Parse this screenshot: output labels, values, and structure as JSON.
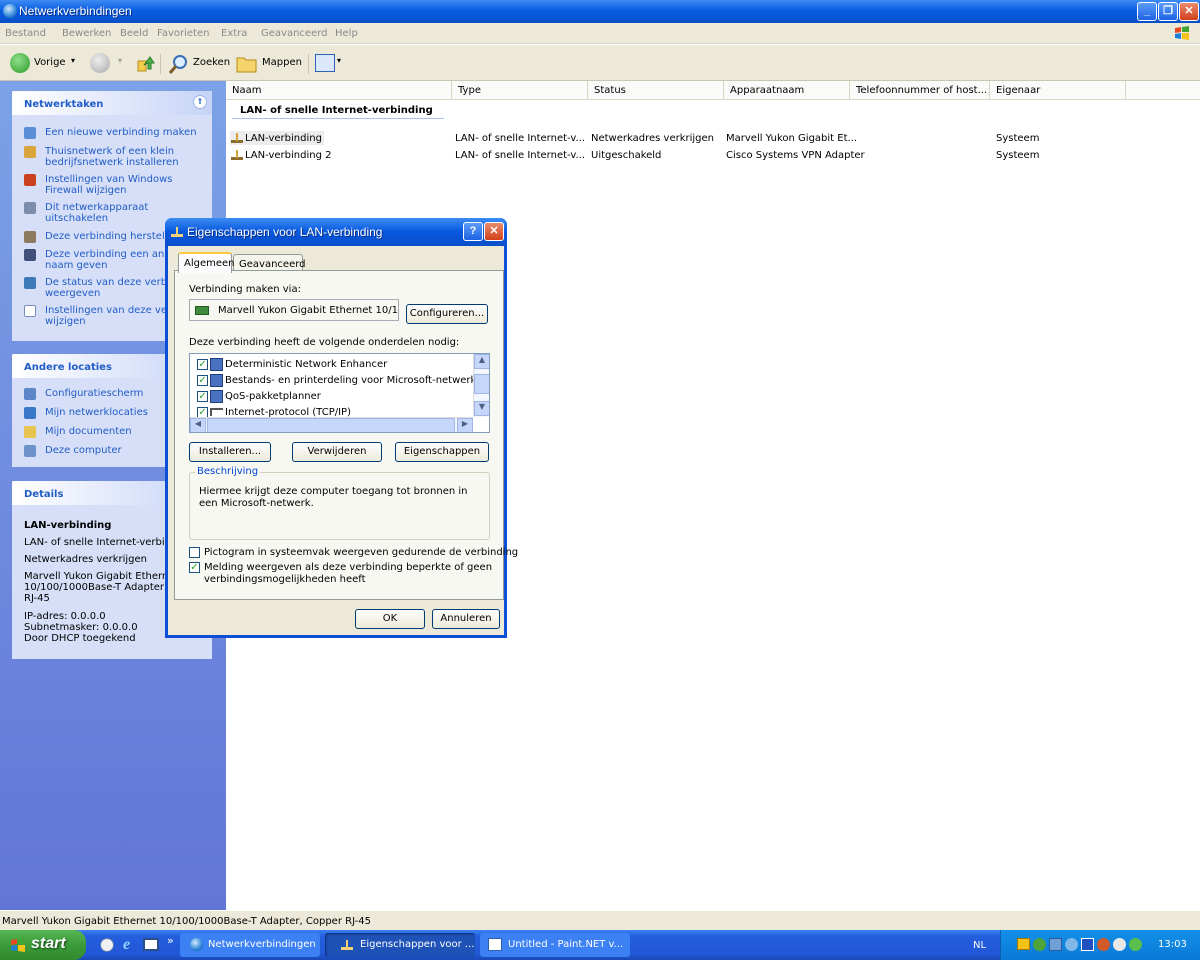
{
  "window": {
    "title": "Netwerkverbindingen"
  },
  "menu": [
    "Bestand",
    "Bewerken",
    "Beeld",
    "Favorieten",
    "Extra",
    "Geavanceerd",
    "Help"
  ],
  "toolbar": {
    "back": "Vorige",
    "search": "Zoeken",
    "folders": "Mappen"
  },
  "tasks_panel": {
    "title": "Netwerktaken",
    "items": [
      {
        "l1": "Een nieuwe verbinding maken",
        "l2": ""
      },
      {
        "l1": "Thuisnetwerk of een klein",
        "l2": "bedrijfsnetwerk installeren"
      },
      {
        "l1": "Instellingen van Windows",
        "l2": "Firewall wijzigen"
      },
      {
        "l1": "Dit netwerkapparaat",
        "l2": "uitschakelen"
      },
      {
        "l1": "Deze verbinding herstellen",
        "l2": ""
      },
      {
        "l1": "Deze verbinding een ander",
        "l2": "naam geven"
      },
      {
        "l1": "De status van deze verbind",
        "l2": "weergeven"
      },
      {
        "l1": "Instellingen van deze verb",
        "l2": "wijzigen"
      }
    ]
  },
  "places_panel": {
    "title": "Andere locaties",
    "items": [
      "Configuratiescherm",
      "Mijn netwerklocaties",
      "Mijn documenten",
      "Deze computer"
    ]
  },
  "details_panel": {
    "title": "Details",
    "name": "LAN-verbinding",
    "lines": [
      "LAN- of snelle Internet-verbind",
      "Netwerkadres verkrijgen",
      "Marvell Yukon Gigabit Ethernet",
      "10/100/1000Base-T Adapter, C",
      "RJ-45",
      "IP-adres: 0.0.0.0",
      "Subnetmasker: 0.0.0.0",
      "Door DHCP toegekend"
    ]
  },
  "list": {
    "columns": [
      "Naam",
      "Type",
      "Status",
      "Apparaatnaam",
      "Telefoonnummer of host...",
      "Eigenaar"
    ],
    "group": "LAN- of snelle Internet-verbinding",
    "rows": [
      {
        "name": "LAN-verbinding",
        "type": "LAN- of snelle Internet-v...",
        "status": "Netwerkadres verkrijgen",
        "device": "Marvell Yukon Gigabit Et...",
        "phone": "",
        "owner": "Systeem"
      },
      {
        "name": "LAN-verbinding 2",
        "type": "LAN- of snelle Internet-v...",
        "status": "Uitgeschakeld",
        "device": "Cisco Systems VPN Adapter",
        "phone": "",
        "owner": "Systeem"
      }
    ]
  },
  "dialog": {
    "title": "Eigenschappen voor LAN-verbinding",
    "tabs": [
      "Algemeen",
      "Geavanceerd"
    ],
    "connect_label": "Verbinding maken via:",
    "adapter": "Marvell Yukon Gigabit Ethernet 10/1",
    "configure": "Configureren...",
    "components_label": "Deze verbinding heeft de volgende onderdelen nodig:",
    "components": [
      {
        "label": "Deterministic Network Enhancer",
        "checked": true
      },
      {
        "label": "Bestands- en printerdeling voor Microsoft-netwerken",
        "checked": true
      },
      {
        "label": "QoS-pakketplanner",
        "checked": true
      },
      {
        "label": "Internet-protocol (TCP/IP)",
        "checked": true
      }
    ],
    "install": "Installeren...",
    "remove": "Verwijderen",
    "properties": "Eigenschappen",
    "description_title": "Beschrijving",
    "description": "Hiermee krijgt deze computer toegang tot bronnen in een Microsoft-netwerk.",
    "option1": {
      "label": "Pictogram in systeemvak weergeven gedurende de verbinding",
      "checked": false
    },
    "option2": {
      "label1": "Melding weergeven als deze verbinding beperkte of geen",
      "label2": "verbindingsmogelijkheden heeft",
      "checked": true
    },
    "ok": "OK",
    "cancel": "Annuleren"
  },
  "statusbar": "Marvell Yukon Gigabit Ethernet 10/100/1000Base-T Adapter, Copper RJ-45",
  "taskbar": {
    "start": "start",
    "tasks": [
      {
        "label": "Netwerkverbindingen",
        "active": false
      },
      {
        "label": "Eigenschappen voor ...",
        "active": true
      },
      {
        "label": "Untitled - Paint.NET v...",
        "active": false
      }
    ],
    "lang": "NL",
    "clock": "13:03"
  }
}
